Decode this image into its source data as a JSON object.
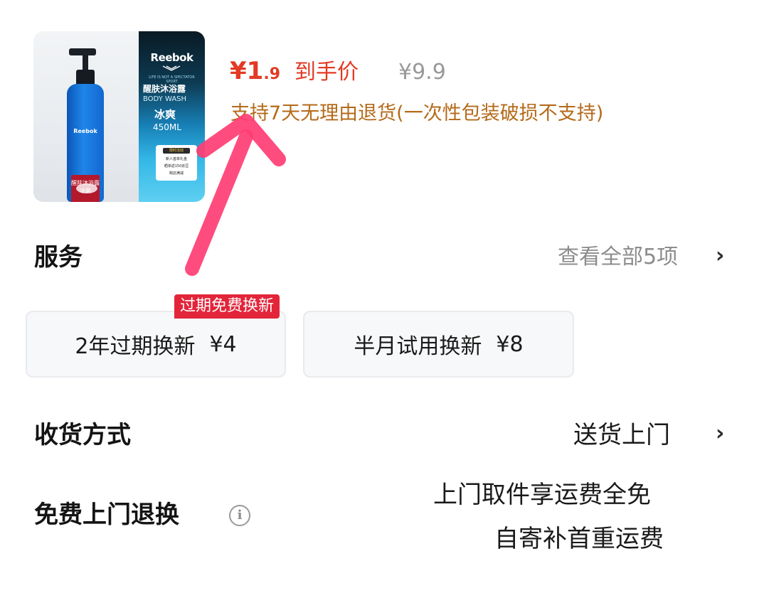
{
  "product": {
    "image": {
      "bottle_brand": "Reebok",
      "bottle_label": "醒肤沐浴露",
      "bottle_variant": "冰爽",
      "panel_brand": "Reebok",
      "panel_tagline": "LIFE IS NOT A SPECTATOR SPORT",
      "panel_cn_title": "醒肤沐浴露",
      "panel_en_title": "BODY WASH",
      "panel_variant": "冰爽",
      "panel_volume": "450ML",
      "promo_head": "限时活动",
      "promo_line1": "新人首单礼金",
      "promo_line2": "晒单返150京豆",
      "promo_line3": "跨店满减"
    },
    "price_symbol": "¥",
    "price_integer": "1",
    "price_decimal": ".9",
    "price_label": "到手价",
    "original_price": "¥9.9",
    "return_policy": "支持7天无理由退货(一次性包装破损不支持)"
  },
  "service": {
    "title": "服务",
    "view_all": "查看全部5项",
    "badge": "过期免费换新",
    "options": [
      {
        "name": "2年过期换新",
        "price": "¥4"
      },
      {
        "name": "半月试用换新",
        "price": "¥8"
      }
    ]
  },
  "shipping": {
    "title": "收货方式",
    "value": "送货上门"
  },
  "free_return": {
    "title": "免费上门退换",
    "line1": "上门取件享运费全免",
    "line2": "自寄补首重运费"
  },
  "icons": {
    "chevron": "›",
    "info": "i"
  },
  "colors": {
    "price_red": "#e23a24",
    "policy_brown": "#b46a1a",
    "badge_red": "#e3253a",
    "arrow_pink": "#ff3d73"
  }
}
